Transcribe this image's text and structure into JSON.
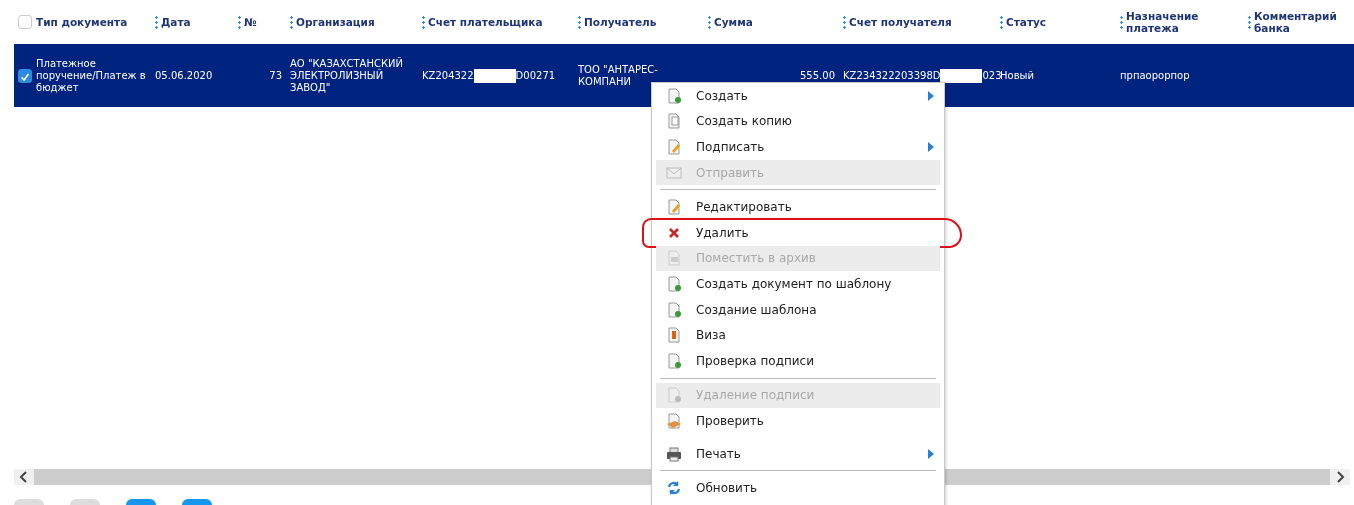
{
  "table": {
    "select_all": {
      "checked": false
    },
    "columns": [
      "Тип документа",
      "Дата",
      "№",
      "Организация",
      "Счет плательщика",
      "Получатель",
      "Сумма",
      "Счет получателя",
      "Статус",
      "Назначение платежа",
      "Комментарий банка"
    ],
    "rows": [
      {
        "selected": true,
        "checked": true,
        "cells": [
          {
            "text": "Платежное поручение/Платеж в бюджет"
          },
          {
            "text": "05.06.2020"
          },
          {
            "text": "73"
          },
          {
            "text": "АО \"КАЗАХСТАНСКИЙ ЭЛЕКТРОЛИЗНЫЙ ЗАВОД\""
          },
          {
            "parts": [
              "KZ204322",
              "D00271"
            ]
          },
          {
            "text": "ТОО \"АНТАРЕС-КОМПАНИ"
          },
          {
            "text": "555.00"
          },
          {
            "parts": [
              "KZ234322203398D",
              "023"
            ]
          },
          {
            "text": "Новый"
          },
          {
            "text": "прпаорорпор"
          },
          {
            "text": ""
          }
        ]
      }
    ]
  },
  "context_menu": {
    "items": [
      {
        "kind": "item",
        "label": "Создать",
        "disabled": false,
        "submenu": true,
        "highlighted": false
      },
      {
        "kind": "item",
        "label": "Создать копию",
        "disabled": false,
        "submenu": false,
        "highlighted": false
      },
      {
        "kind": "item",
        "label": "Подписать",
        "disabled": false,
        "submenu": true,
        "highlighted": false
      },
      {
        "kind": "item",
        "label": "Отправить",
        "disabled": true,
        "submenu": false,
        "highlighted": false
      },
      {
        "kind": "separator"
      },
      {
        "kind": "item",
        "label": "Редактировать",
        "disabled": false,
        "submenu": false,
        "highlighted": false
      },
      {
        "kind": "item",
        "label": "Удалить",
        "disabled": false,
        "submenu": false,
        "highlighted": true
      },
      {
        "kind": "item",
        "label": "Поместить в архив",
        "disabled": true,
        "submenu": false,
        "highlighted": false
      },
      {
        "kind": "item",
        "label": "Создать документ по шаблону",
        "disabled": false,
        "submenu": false,
        "highlighted": false
      },
      {
        "kind": "item",
        "label": "Создание шаблона",
        "disabled": false,
        "submenu": false,
        "highlighted": false
      },
      {
        "kind": "item",
        "label": "Виза",
        "disabled": false,
        "submenu": false,
        "highlighted": false
      },
      {
        "kind": "item",
        "label": "Проверка подписи",
        "disabled": false,
        "submenu": false,
        "highlighted": false
      },
      {
        "kind": "separator"
      },
      {
        "kind": "item",
        "label": "Удаление подписи",
        "disabled": true,
        "submenu": false,
        "highlighted": false
      },
      {
        "kind": "item",
        "label": "Проверить",
        "disabled": false,
        "submenu": false,
        "highlighted": false
      },
      {
        "kind": "spacer"
      },
      {
        "kind": "item",
        "label": "Печать",
        "disabled": false,
        "submenu": true,
        "highlighted": false
      },
      {
        "kind": "separator"
      },
      {
        "kind": "item",
        "label": "Обновить",
        "disabled": false,
        "submenu": false,
        "highlighted": false
      }
    ]
  }
}
